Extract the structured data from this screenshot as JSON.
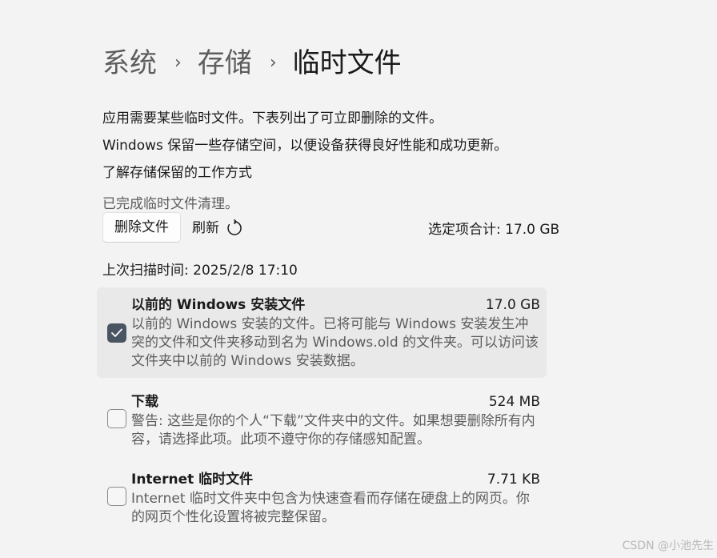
{
  "breadcrumb": {
    "items": [
      "系统",
      "存储"
    ],
    "current": "临时文件",
    "separator": "›"
  },
  "description": {
    "line1": "应用需要某些临时文件。下表列出了可立即删除的文件。",
    "line2": "Windows 保留一些存储空间，以便设备获得良好性能和成功更新。"
  },
  "link_text": "了解存储保留的工作方式",
  "status_text": "已完成临时文件清理。",
  "actions": {
    "delete_label": "删除文件",
    "refresh_label": "刷新"
  },
  "total_text": "选定项合计: 17.0 GB",
  "scan_time_text": "上次扫描时间: 2025/2/8 17:10",
  "items": [
    {
      "title": "以前的 Windows 安装文件",
      "size": "17.0 GB",
      "description": "以前的 Windows 安装的文件。已将可能与 Windows 安装发生冲突的文件和文件夹移动到名为 Windows.old 的文件夹。可以访问该文件夹中以前的 Windows 安装数据。",
      "checked": true
    },
    {
      "title": "下载",
      "size": "524 MB",
      "description": "警告: 这些是你的个人“下载”文件夹中的文件。如果想要删除所有内容，请选择此项。此项不遵守你的存储感知配置。",
      "checked": false
    },
    {
      "title": "Internet 临时文件",
      "size": "7.71 KB",
      "description": "Internet 临时文件夹中包含为快速查看而存储在硬盘上的网页。你的网页个性化设置将被完整保留。",
      "checked": false
    }
  ],
  "watermark": "CSDN @小池先生",
  "colors": {
    "background": "#f3f3f3",
    "checkbox_checked": "#4a5563",
    "selected_row": "#e9e9e9"
  },
  "icons": {
    "refresh": "refresh-icon",
    "check": "checkmark-icon",
    "separator": "chevron-right-icon"
  }
}
